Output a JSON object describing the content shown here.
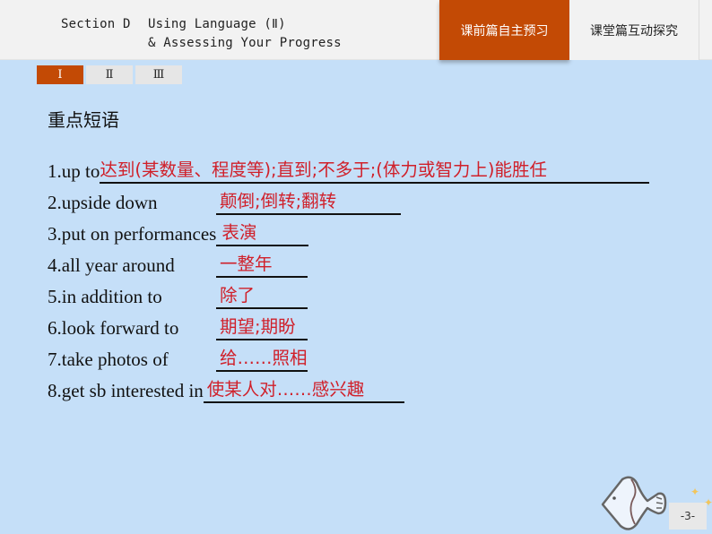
{
  "header": {
    "section_label": "Section D",
    "title_line1": "Using Language (Ⅱ)",
    "title_line2": "& Assessing Your Progress",
    "nav_tabs": [
      {
        "label": "课前篇自主预习",
        "active": true
      },
      {
        "label": "课堂篇互动探究",
        "active": false
      }
    ]
  },
  "roman_tabs": [
    {
      "label": "Ⅰ",
      "active": true
    },
    {
      "label": "Ⅱ",
      "active": false
    },
    {
      "label": "Ⅲ",
      "active": false
    }
  ],
  "section_heading": "重点短语",
  "phrases": [
    {
      "en": "1.up to",
      "answer": "达到(某数量、程度等);直到;不多于;(体力或智力上)能胜任"
    },
    {
      "en": "2.upside down",
      "answer": "颠倒;倒转;翻转"
    },
    {
      "en": "3.put on performances",
      "answer": "表演"
    },
    {
      "en": "4.all year around",
      "answer": "一整年"
    },
    {
      "en": "5.in addition to",
      "answer": "除了"
    },
    {
      "en": "6.look forward to",
      "answer": "期望;期盼"
    },
    {
      "en": "7.take photos of",
      "answer": "给……照相"
    },
    {
      "en": "8.get sb interested in",
      "answer": "使某人对……感兴趣"
    }
  ],
  "decor": {
    "fish_icon": "fish-icon",
    "star_icon": "star-icon"
  },
  "page_number": "-3-",
  "colors": {
    "accent": "#c34a05",
    "answer": "#d0202a",
    "background": "#c5dff8"
  }
}
